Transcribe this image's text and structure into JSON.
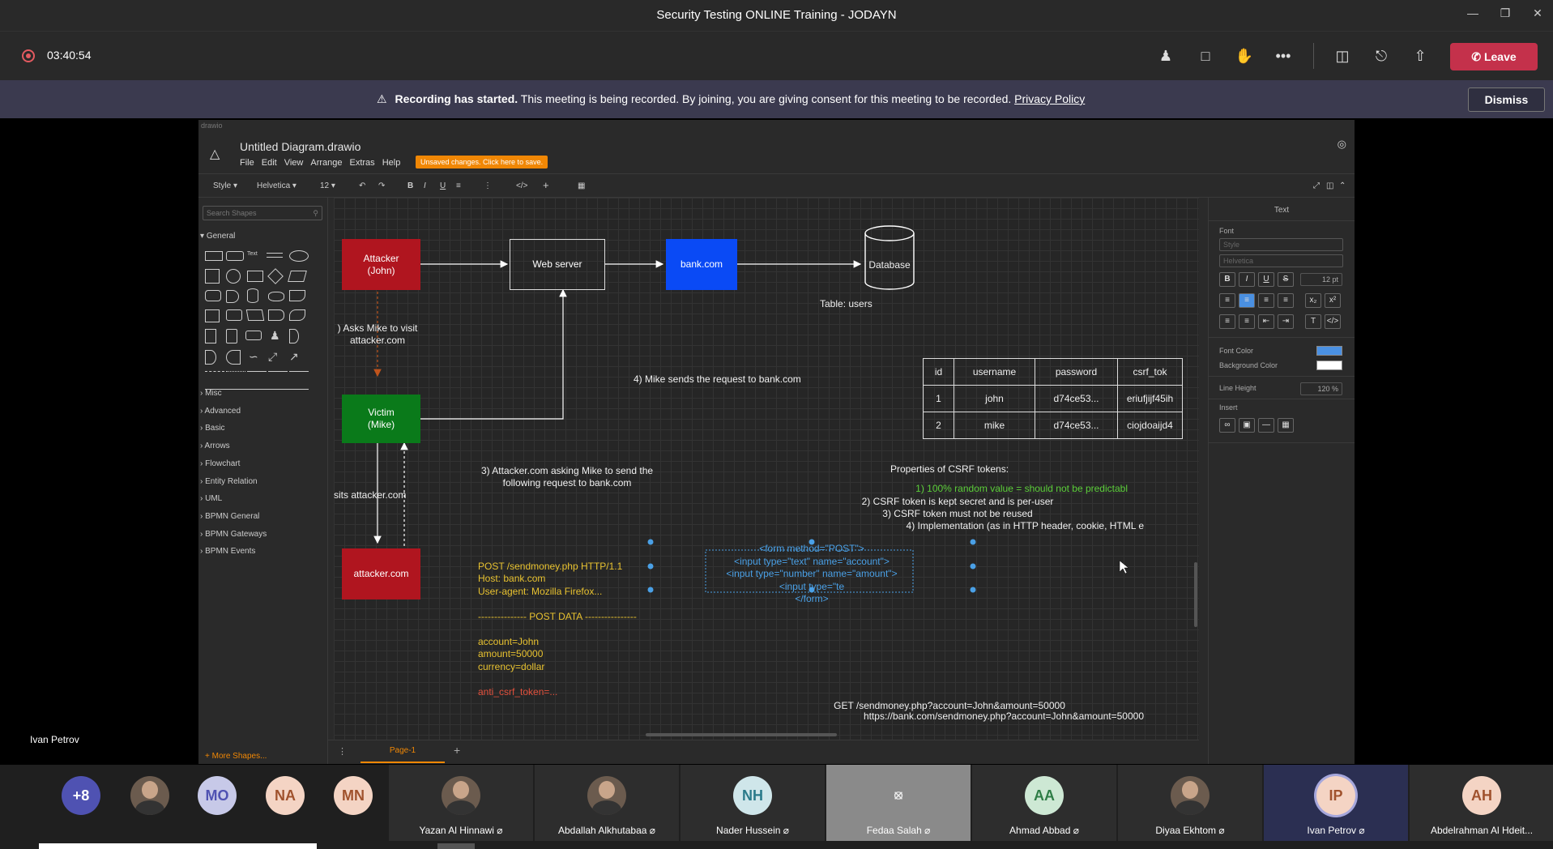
{
  "window": {
    "title": "Security Testing ONLINE Training - JODAYN"
  },
  "call": {
    "timer": "03:40:54",
    "leave_label": "Leave"
  },
  "banner": {
    "bold": "Recording has started.",
    "text": "This meeting is being recorded. By joining, you are giving consent for this meeting to be recorded.",
    "link": "Privacy Policy",
    "dismiss_label": "Dismiss"
  },
  "presenter": {
    "name": "Ivan Petrov"
  },
  "drawio": {
    "corner_text": "drawio",
    "file_title": "Untitled Diagram.drawio",
    "menu": [
      "File",
      "Edit",
      "View",
      "Arrange",
      "Extras",
      "Help"
    ],
    "unsaved": "Unsaved changes. Click here to save.",
    "toolbar": {
      "style": "Style",
      "font": "Helvetica",
      "size": "12"
    },
    "search_placeholder": "Search Shapes",
    "general_label": "General",
    "categories": [
      "Misc",
      "Advanced",
      "Basic",
      "Arrows",
      "Flowchart",
      "Entity Relation",
      "UML",
      "BPMN General",
      "BPMN Gateways",
      "BPMN Events"
    ],
    "more_shapes": "More Shapes...",
    "page_tab": "Page-1",
    "format_panel": {
      "title": "Text",
      "font_label": "Font",
      "style_placeholder": "Style",
      "font_value": "Helvetica",
      "size_value": "12 pt",
      "font_color_label": "Font Color",
      "bg_color_label": "Background Color",
      "line_height_label": "Line Height",
      "line_height_value": "120 %",
      "insert_label": "Insert",
      "font_color": "#4a90e2",
      "bg_color": "#ffffff"
    }
  },
  "diagram": {
    "attacker": "Attacker\n(John)",
    "webserver": "Web server",
    "bank": "bank.com",
    "database": "Database",
    "victim": "Victim\n(Mike)",
    "attacker_site": "attacker.com",
    "step1": ") Asks Mike to visit\nattacker.com",
    "step2": "sits attacker.com",
    "step3": "3) Attacker.com asking Mike to send the\nfollowing request to bank.com",
    "step4": "4) Mike sends the request to bank.com",
    "request_lines": [
      "POST /sendmoney.php HTTP/1.1",
      "Host: bank.com",
      "User-agent: Mozilla Firefox...",
      "",
      "--------------- POST DATA ----------------",
      "",
      "account=John",
      "amount=50000",
      "currency=dollar"
    ],
    "token_line": "anti_csrf_token=...",
    "form_lines": [
      "<form method=\"POST\">",
      "<input type=\"text\" name=\"account\">",
      "<input type=\"number\" name=\"amount\">",
      "<input type=\"te",
      "</form>"
    ],
    "table_title": "Table: users",
    "table_headers": [
      "id",
      "username",
      "password",
      "csrf_tok"
    ],
    "table_rows": [
      [
        "1",
        "john",
        "d74ce53...",
        "eriufjijf45ih"
      ],
      [
        "2",
        "mike",
        "d74ce53...",
        "ciojdoaijd4"
      ]
    ],
    "props_title": "Properties of CSRF tokens:",
    "prop1": "1) 100% random value = should not be predictabl",
    "prop2": "2) CSRF token is kept secret and is per-user",
    "prop3": "3) CSRF token must not be reused",
    "prop4": "4) Implementation (as in HTTP header, cookie, HTML e",
    "get_line1": "GET /sendmoney.php?account=John&amount=50000",
    "get_line2": "https://bank.com/sendmoney.php?account=John&amount=50000",
    "colors": {
      "attacker": "#b0151f",
      "bank": "#0a4af5",
      "victim": "#0a7a1a",
      "request_text": "#e8c230",
      "token_text": "#e2503c",
      "form_text": "#4aa0e6",
      "prop1_text": "#5ccf3a"
    }
  },
  "participants": [
    {
      "initials": "+8",
      "name": "",
      "bg": "#4f52b2",
      "fg": "#ffffff"
    },
    {
      "initials": "",
      "name": "",
      "photo": true
    },
    {
      "initials": "MO",
      "name": "",
      "bg": "#c7c9e8",
      "fg": "#4f52b2"
    },
    {
      "initials": "NA",
      "name": "",
      "bg": "#f4d4c4",
      "fg": "#a0522d"
    },
    {
      "initials": "MN",
      "name": "",
      "bg": "#f4d4c4",
      "fg": "#a0522d"
    },
    {
      "initials": "",
      "name": "Yazan Al Hinnawi",
      "photo": true
    },
    {
      "initials": "",
      "name": "Abdallah Alkhutabaa",
      "photo": true
    },
    {
      "initials": "NH",
      "name": "Nader Hussein",
      "bg": "#cfe6ea",
      "fg": "#2a7a8a"
    },
    {
      "initials": "",
      "name": "Fedaa Salah",
      "camoff": true
    },
    {
      "initials": "AA",
      "name": "Ahmad Abbad",
      "bg": "#cde8d4",
      "fg": "#2e7d46"
    },
    {
      "initials": "",
      "name": "Diyaa Ekhtom",
      "photo": true
    },
    {
      "initials": "IP",
      "name": "Ivan Petrov",
      "bg": "#f4d4c4",
      "fg": "#a0522d"
    },
    {
      "initials": "AH",
      "name": "Abdelrahman Al Hdeit...",
      "bg": "#f4d4c4",
      "fg": "#a0522d"
    }
  ]
}
